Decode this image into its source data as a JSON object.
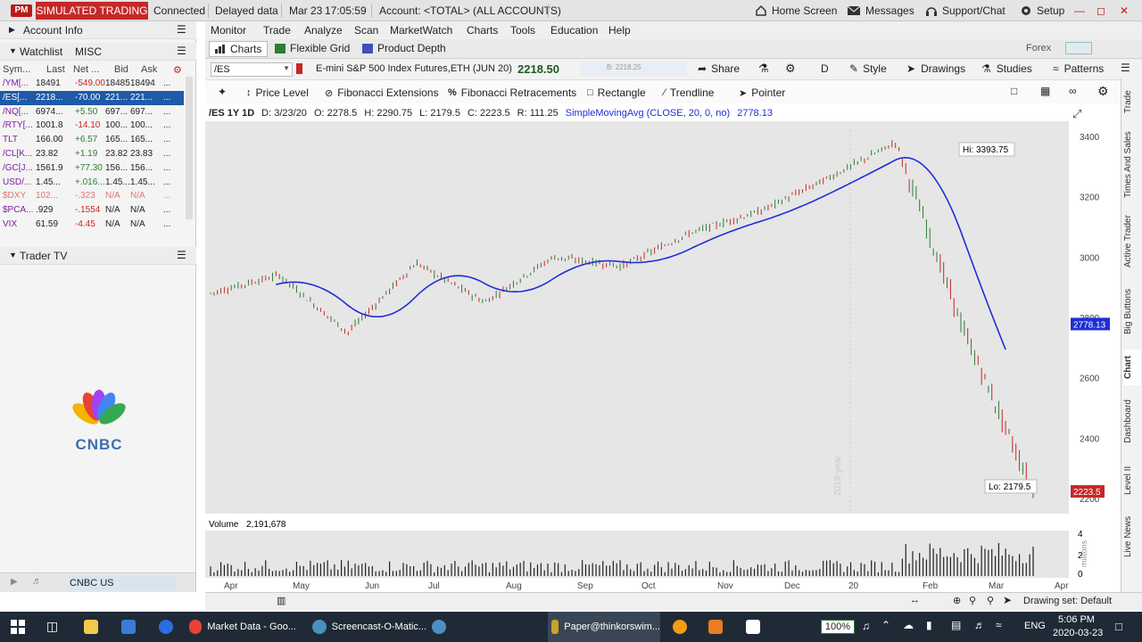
{
  "topbar": {
    "badge": "PM",
    "mode": "SIMULATED TRADING",
    "connection": "Connected",
    "data_status": "Delayed data",
    "date": "Mar 23",
    "time": "17:05:59",
    "account": "Account: <TOTAL> (ALL ACCOUNTS)",
    "home_screen": "Home Screen",
    "messages": "Messages",
    "support": "Support/Chat",
    "setup": "Setup"
  },
  "menu": {
    "items": [
      "Monitor",
      "Trade",
      "Analyze",
      "Scan",
      "MarketWatch",
      "Charts",
      "Tools",
      "Education",
      "Help"
    ]
  },
  "subtabs": {
    "charts": "Charts",
    "flexible_grid": "Flexible Grid",
    "product_depth": "Product Depth",
    "forex": "Forex"
  },
  "left": {
    "account_info": "Account Info",
    "watchlist_tab": "Watchlist",
    "misc_tab": "MISC",
    "columns": [
      "Sym...",
      "Last",
      "Net ...",
      "Bid",
      "Ask"
    ],
    "rows": [
      {
        "sym": "/YM[...",
        "last": "18491",
        "net": "-549.00",
        "bid": "18485",
        "ask": "18494",
        "more": "...",
        "net_color": "#c62828"
      },
      {
        "sym": "/ES[...",
        "last": "2218...",
        "net": "-70.00",
        "bid": "221...",
        "ask": "221...",
        "more": "...",
        "net_color": "#c62828"
      },
      {
        "sym": "/NQ[...",
        "last": "6974...",
        "net": "+5.50",
        "bid": "697...",
        "ask": "697...",
        "more": "...",
        "net_color": "#2e7d32"
      },
      {
        "sym": "/RTY[...",
        "last": "1001.8",
        "net": "-14.10",
        "bid": "100...",
        "ask": "100...",
        "more": "...",
        "net_color": "#c62828"
      },
      {
        "sym": "TLT",
        "last": "166.00",
        "net": "+6.57",
        "bid": "165...",
        "ask": "165...",
        "more": "...",
        "net_color": "#2e7d32"
      },
      {
        "sym": "/CL[K...",
        "last": "23.82",
        "net": "+1.19",
        "bid": "23.82",
        "ask": "23.83",
        "more": "...",
        "net_color": "#2e7d32"
      },
      {
        "sym": "/GC[J...",
        "last": "1561.9",
        "net": "+77.30",
        "bid": "156...",
        "ask": "156...",
        "more": "...",
        "net_color": "#2e7d32"
      },
      {
        "sym": "USD/...",
        "last": "1.45...",
        "net": "+.016...",
        "bid": "1.45...",
        "ask": "1.45...",
        "more": "...",
        "net_color": "#2e7d32"
      },
      {
        "sym": "$DXY",
        "last": "102...",
        "net": "-.323",
        "bid": "N/A",
        "ask": "N/A",
        "more": "...",
        "net_color": "#e57373"
      },
      {
        "sym": "$PCA...",
        "last": ".929",
        "net": "-.1554",
        "bid": "N/A",
        "ask": "N/A",
        "more": "...",
        "net_color": "#c62828"
      },
      {
        "sym": "VIX",
        "last": "61.59",
        "net": "-4.45",
        "bid": "N/A",
        "ask": "N/A",
        "more": "...",
        "net_color": "#c62828"
      }
    ],
    "trader_tv": "Trader TV",
    "cnbc": "CNBC",
    "cnbc_channel": "CNBC US"
  },
  "symbol_bar": {
    "symbol": "/ES",
    "description": "E-mini S&P 500 Index Futures,ETH (JUN 20)",
    "last": "2218.50",
    "bid": "B: 2218.25",
    "share": "Share",
    "period": "D",
    "style": "Style",
    "drawings": "Drawings",
    "studies": "Studies",
    "patterns": "Patterns"
  },
  "drawing_tools": {
    "price_level": "Price Level",
    "fib_ext": "Fibonacci Extensions",
    "fib_ret": "Fibonacci Retracements",
    "rectangle": "Rectangle",
    "trendline": "Trendline",
    "pointer": "Pointer"
  },
  "ohlc": {
    "tag": "/ES 1Y 1D",
    "date": "D: 3/23/20",
    "open": "O: 2278.5",
    "high": "H: 2290.75",
    "low": "L: 2179.5",
    "close": "C: 2223.5",
    "range": "R: 111.25",
    "study": "SimpleMovingAvg (CLOSE, 20, 0, no)",
    "study_value": "2778.13"
  },
  "chart_data": {
    "type": "candlestick",
    "y_axis_ticks": [
      3400,
      3200,
      3000,
      2800,
      2600,
      2400,
      2200
    ],
    "ylim": [
      2150,
      3450
    ],
    "x_ticks": [
      "Apr",
      "May",
      "Jun",
      "Jul",
      "Aug",
      "Sep",
      "Oct",
      "Nov",
      "Dec",
      "20",
      "Feb",
      "Mar",
      "Apr"
    ],
    "high_label": "Hi: 3393.75",
    "low_label": "Lo: 2179.5",
    "sma_marker": "2778.13",
    "last_marker": "2223.5",
    "closes_approx": [
      {
        "month": "Apr",
        "close": 2880
      },
      {
        "month": "May",
        "close": 2940
      },
      {
        "month": "Jun",
        "close": 2750
      },
      {
        "month": "Jul",
        "close": 2980
      },
      {
        "month": "Aug",
        "close": 2850
      },
      {
        "month": "Sep",
        "close": 3000
      },
      {
        "month": "Oct",
        "close": 2970
      },
      {
        "month": "Nov",
        "close": 3080
      },
      {
        "month": "Dec",
        "close": 3150
      },
      {
        "month": "20",
        "close": 3260
      },
      {
        "month": "Feb",
        "close": 3380
      },
      {
        "month": "Mar",
        "close": 2750
      },
      {
        "month": "Mar end",
        "close": 2223.5
      }
    ],
    "colors": {
      "up": "#2e7d32",
      "down": "#c62828",
      "sma": "#1f2fd4"
    },
    "volume_label": "Volume",
    "volume_value": "2,191,678",
    "volume_ticks": [
      "4",
      "2",
      "0"
    ],
    "volume_unit": "millions",
    "watermark": "2019-year"
  },
  "bottom_bar": {
    "drawing_set": "Drawing set: Default"
  },
  "right_tabs": [
    "Trade",
    "Times And Sales",
    "Active Trader",
    "Big Buttons",
    "Chart",
    "Dashboard",
    "Level II",
    "Live News"
  ],
  "taskbar": {
    "chrome_task": "Market Data - Goo...",
    "screencast_task": "Screencast-O-Matic...",
    "tos_task": "Paper@thinkorswim...",
    "battery": "100%",
    "lang": "ENG",
    "clock_time": "5:06 PM",
    "clock_date": "2020-03-23"
  }
}
